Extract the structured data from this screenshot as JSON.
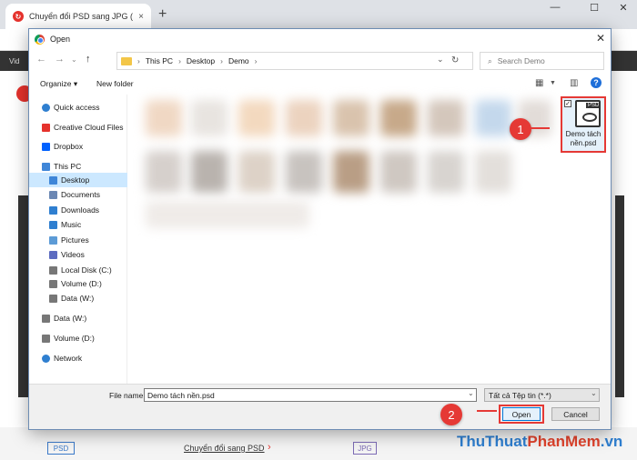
{
  "browser": {
    "tab_title": "Chuyển đổi PSD sang JPG (Trực tuy",
    "tab_close": "×",
    "new_tab": "+",
    "min": "—",
    "max": "☐",
    "close": "✕",
    "sitebar_text": "Vid"
  },
  "page": {
    "psd_tag": "PSD",
    "convert_link": "Chuyển đổi sang PSD",
    "convert_arrow": "›",
    "jpg_tag": "JPG",
    "watermark": [
      "ThuThuat",
      "PhanMem",
      ".vn"
    ]
  },
  "dialog": {
    "title": "Open",
    "close": "✕",
    "breadcrumb": [
      "This PC",
      "Desktop",
      "Demo"
    ],
    "search_placeholder": "Search Demo",
    "organize_label": "Organize ▾",
    "new_folder_label": "New folder",
    "help": "?",
    "nav_items": [
      {
        "label": "Quick access",
        "icon": "star-icon",
        "color": "#2f7fd0"
      },
      {
        "label": "Creative Cloud Files",
        "icon": "creative-cloud-icon",
        "color": "#e5322d"
      },
      {
        "label": "Dropbox",
        "icon": "dropbox-icon",
        "color": "#0061fe"
      },
      {
        "label": "This PC",
        "icon": "computer-icon",
        "color": "#3f86d8"
      },
      {
        "label": "Desktop",
        "icon": "desktop-icon",
        "color": "#3f86d8"
      },
      {
        "label": "Documents",
        "icon": "documents-icon",
        "color": "#6b87b3"
      },
      {
        "label": "Downloads",
        "icon": "downloads-icon",
        "color": "#2f7fd0"
      },
      {
        "label": "Music",
        "icon": "music-icon",
        "color": "#2f7fd0"
      },
      {
        "label": "Pictures",
        "icon": "pictures-icon",
        "color": "#5c9bd6"
      },
      {
        "label": "Videos",
        "icon": "videos-icon",
        "color": "#5c6bc0"
      },
      {
        "label": "Local Disk (C:)",
        "icon": "drive-icon",
        "color": "#777777"
      },
      {
        "label": "Volume (D:)",
        "icon": "drive-icon",
        "color": "#777777"
      },
      {
        "label": "Data (W:)",
        "icon": "drive-icon",
        "color": "#777777"
      },
      {
        "label": "Data (W:)",
        "icon": "drive-icon",
        "color": "#777777"
      },
      {
        "label": "Volume (D:)",
        "icon": "drive-icon",
        "color": "#777777"
      },
      {
        "label": "Network",
        "icon": "network-icon",
        "color": "#2f7fd0"
      }
    ],
    "selected_nav": "Desktop",
    "file": {
      "label_line1": "Demo tách",
      "label_line2": "nền.psd",
      "psd_tag": "PSD",
      "checked": "✓"
    },
    "step1": "1",
    "step2": "2",
    "filename_label": "File name:",
    "filename_value": "Demo tách nền.psd",
    "filetype_value": "Tất cả Tệp tin (*.*)",
    "open_label": "Open",
    "cancel_label": "Cancel"
  },
  "colors": {
    "accent": "#e53935",
    "selection": "#cce8ff",
    "brand": "#e5322d"
  }
}
